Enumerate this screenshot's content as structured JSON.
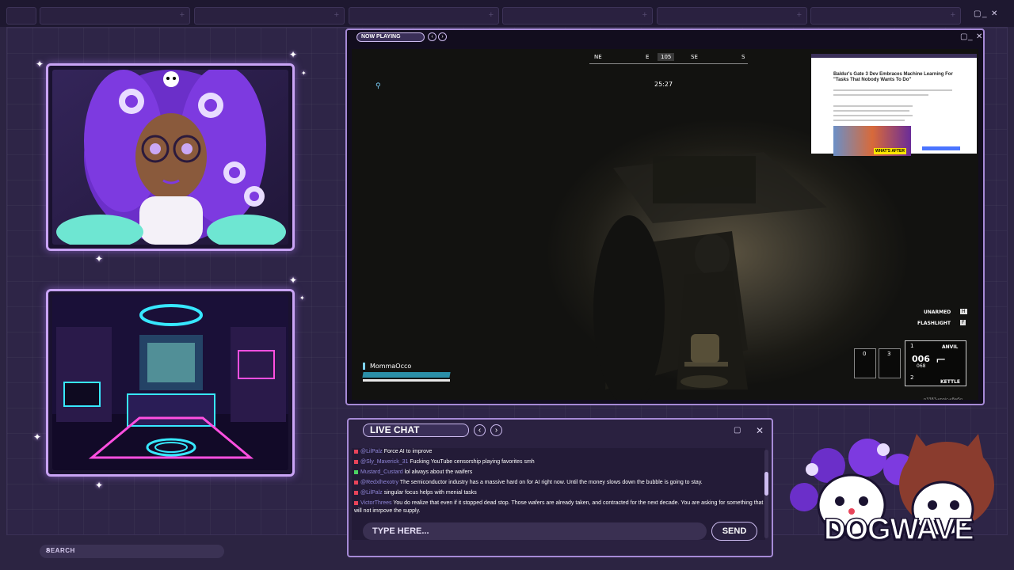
{
  "window": {
    "min": "▢",
    "restore": "_",
    "close": "✕"
  },
  "player_window": {
    "label": "NOW PLAYING",
    "prev": "‹",
    "next": "›",
    "controls": {
      "min": "▢",
      "restore": "_",
      "close": "✕"
    }
  },
  "game": {
    "compass": {
      "labels": [
        "NE",
        "E",
        "SE",
        "S"
      ],
      "heading": "105"
    },
    "timer": "25:27",
    "inset_article": {
      "headline": "Baldur's Gate 3 Dev Embraces Machine Learning For \"Tasks That Nobody Wants To Do\"",
      "thumb_badge": "WHAT'S AFTER"
    },
    "player_name": "MommaOcco",
    "weapons": {
      "unarmed_label": "UNARMED",
      "unarmed_key": "H",
      "flashlight_label": "FLASHLIGHT",
      "flashlight_key": "F",
      "slot_one": "1",
      "slot_one_name": "ANVIL",
      "ammo": "006",
      "ammo_reserve": "068",
      "slot_two": "2",
      "slot_two_name": "KETTLE",
      "item_count_left": "0",
      "item_count_right": "3"
    },
    "build_id": "n3383-vpnic-v8w5n"
  },
  "chat": {
    "title": "LIVE CHAT",
    "prev": "‹",
    "next": "›",
    "controls": {
      "min": "▢",
      "close": "✕"
    },
    "messages": [
      {
        "user": "@LilPalz",
        "text": "Force AI to improve"
      },
      {
        "user": "@Sly_Maverick_31",
        "text": "Fucking YouTube censorship playing favorites smh"
      },
      {
        "user": "Mustard_Custard",
        "text": "lol always about the waifers"
      },
      {
        "user": "@Redxlhexotry",
        "text": "The semiconductor industry has a massive hard on for AI right now. Until the money slows down the bubble is going to stay."
      },
      {
        "user": "@LilPalz",
        "text": "singular focus helps with menial tasks"
      },
      {
        "user": "VictorThrees",
        "text": "You do realize that even if it stopped dead stop. Those wafers are already taken, and contracted for the next decade. You are asking for something that will not imrpove the supply."
      }
    ],
    "input_placeholder": "TYPE HERE...",
    "send_label": "SEND"
  },
  "search": {
    "label": "SEARCH",
    "icon": "search-icon"
  },
  "brand": {
    "name": "DOGWAVE"
  },
  "colors": {
    "accent": "#c9a4f5",
    "frame_border": "#a68ad6",
    "background": "#2c2442",
    "chat_username": "#8f86d8"
  }
}
